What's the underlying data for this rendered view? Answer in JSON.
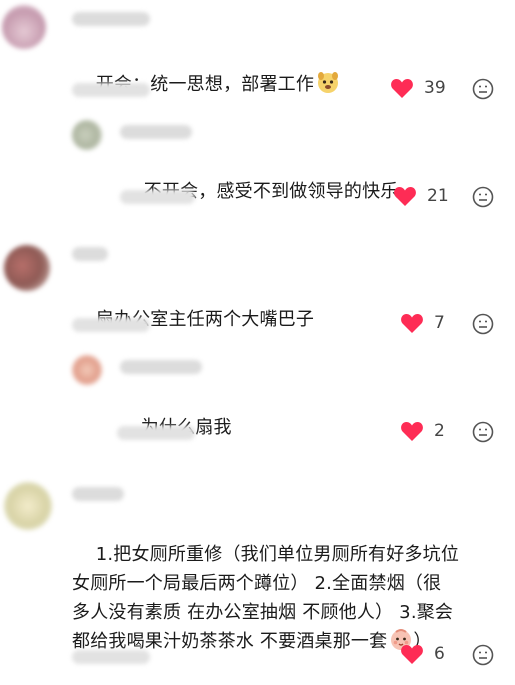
{
  "comments": [
    {
      "id": "c1",
      "text": "开会：统一思想，部署工作",
      "emoji": "dog-emoji",
      "likes": "39"
    },
    {
      "id": "c2",
      "text": "不开会，感受不到做领导的快乐",
      "likes": "21"
    },
    {
      "id": "c3",
      "text": "扇办公室主任两个大嘴巴子",
      "likes": "7"
    },
    {
      "id": "c4",
      "text": "为什么扇我",
      "likes": "2"
    },
    {
      "id": "c5",
      "text": "1.把女厕所重修（我们单位男厕所有好多坑位\n女厕所一个局最后两个蹲位） 2.全面禁烟（很\n多人没有素质 在办公室抽烟 不顾他人） 3.聚会\n都给我喝果汁奶茶茶水 不要酒桌那一套",
      "emoji": "baby-emoji",
      "trail": "）",
      "likes": "6"
    }
  ],
  "colors": {
    "heart": "#fe2c55",
    "icon": "#555555"
  }
}
